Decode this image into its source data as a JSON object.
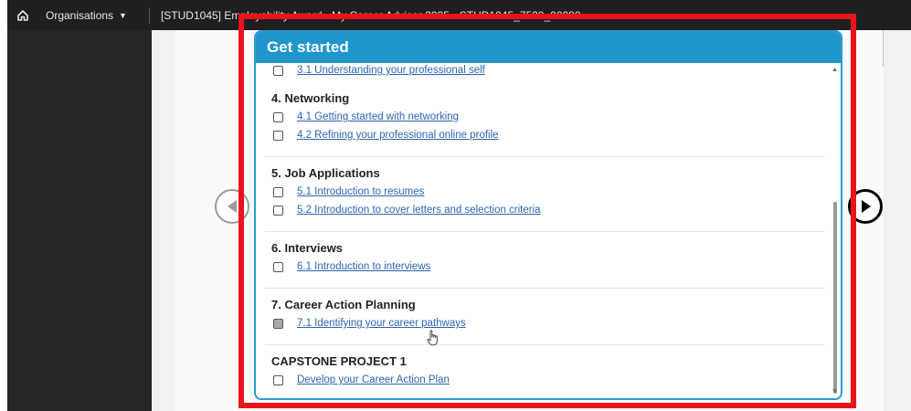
{
  "topbar": {
    "org_label": "Organisations",
    "course_title": "[STUD1045] Employability Award - My Career Adviser 2025 • STUD1045_7520_00080"
  },
  "panel": {
    "title": "Get started",
    "cut_item": "3.1 Understanding your professional self",
    "modules": [
      {
        "title": "4. Networking",
        "items": [
          "4.1 Getting started with networking",
          "4.2 Refining your professional online profile"
        ]
      },
      {
        "title": "5. Job Applications",
        "items": [
          "5.1 Introduction to resumes",
          "5.2 Introduction to cover letters and selection criteria"
        ]
      },
      {
        "title": "6. Interviews",
        "items": [
          "6.1 Introduction to interviews"
        ]
      },
      {
        "title": "7. Career Action Planning",
        "items": [
          "7.1 Identifying your career pathways"
        ]
      },
      {
        "title": "CAPSTONE PROJECT 1",
        "items": [
          "Develop your Career Action Plan"
        ]
      }
    ]
  },
  "icons": {
    "home": "home-icon",
    "dropdown": "caret-down-icon",
    "prev": "previous-arrow-icon",
    "next": "next-arrow-icon",
    "cursor": "hand-pointer-icon"
  },
  "colors": {
    "header_blue": "#1f95cc",
    "link_blue": "#2b66b3",
    "highlight_red": "#e8141b"
  }
}
